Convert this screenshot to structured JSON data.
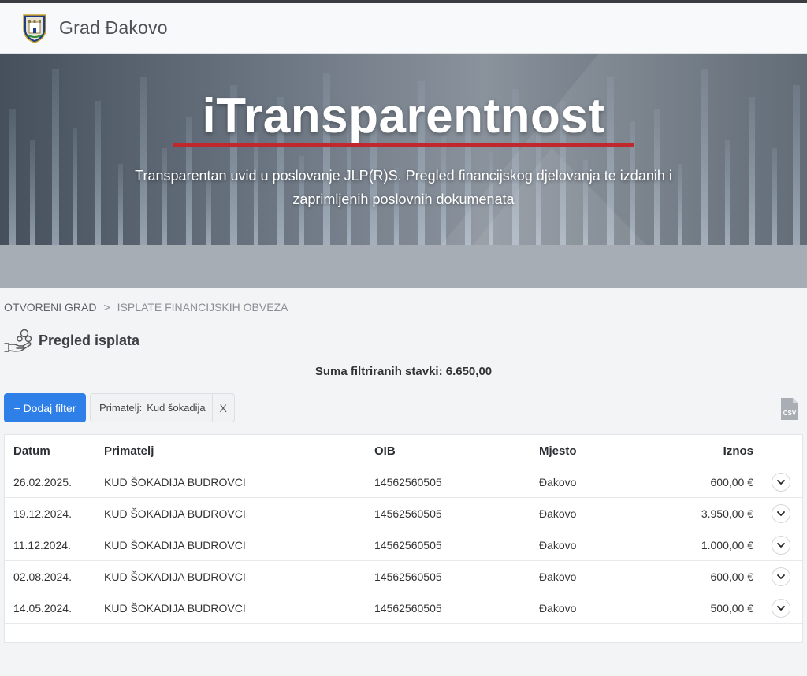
{
  "brand": {
    "title": "Grad Đakovo",
    "logo_icon": "city-crest-icon"
  },
  "hero": {
    "title": "iTransparentnost",
    "subtitle": "Transparentan uvid u poslovanje JLP(R)S. Pregled financijskog djelovanja te izdanih i zaprimljenih poslovnih dokumenata",
    "accent_color": "#c0282e"
  },
  "breadcrumb": {
    "items": [
      "OTVORENI GRAD",
      "ISPLATE FINANCIJSKIH OBVEZA"
    ],
    "separator": ">"
  },
  "section": {
    "title": "Pregled isplata",
    "icon": "hand-coins-icon"
  },
  "summary": {
    "text": "Suma filtriranih stavki: 6.650,00"
  },
  "filters": {
    "add_label": "+ Dodaj filter",
    "active": [
      {
        "label": "Primatelj:",
        "value": "Kud šokadija",
        "close": "X"
      }
    ],
    "export_icon": "csv-file-icon",
    "export_label": "CSV"
  },
  "table": {
    "headers": [
      "Datum",
      "Primatelj",
      "OIB",
      "Mjesto",
      "Iznos"
    ],
    "rows": [
      [
        "26.02.2025.",
        "KUD ŠOKADIJA BUDROVCI",
        "14562560505",
        "Đakovo",
        "600,00 €"
      ],
      [
        "19.12.2024.",
        "KUD ŠOKADIJA BUDROVCI",
        "14562560505",
        "Đakovo",
        "3.950,00 €"
      ],
      [
        "11.12.2024.",
        "KUD ŠOKADIJA BUDROVCI",
        "14562560505",
        "Đakovo",
        "1.000,00 €"
      ],
      [
        "02.08.2024.",
        "KUD ŠOKADIJA BUDROVCI",
        "14562560505",
        "Đakovo",
        "600,00 €"
      ],
      [
        "14.05.2024.",
        "KUD ŠOKADIJA BUDROVCI",
        "14562560505",
        "Đakovo",
        "500,00 €"
      ]
    ],
    "row_action_icon": "chevron-down-icon"
  },
  "colors": {
    "primary": "#2f7fe8",
    "accent": "#c0282e",
    "band": "#a6adb5",
    "background": "#f3f4f6"
  }
}
